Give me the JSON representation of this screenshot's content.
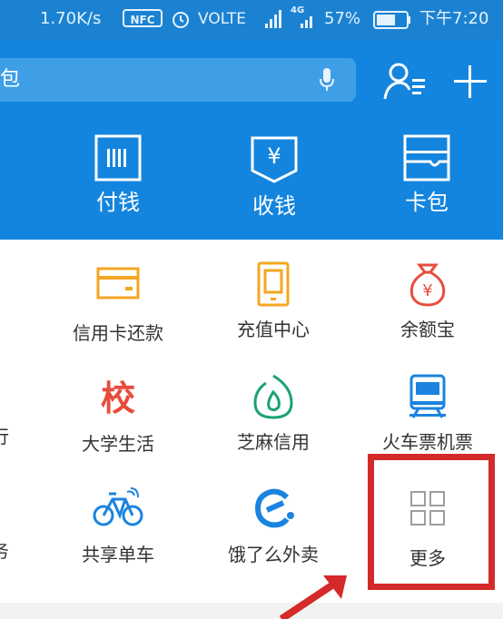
{
  "status_bar": {
    "speed": "1.70K/s",
    "nfc": "NFC",
    "volte": "VOLTE",
    "network": "4G",
    "battery": "57%",
    "time": "下午7:20"
  },
  "search": {
    "visible_text": "包"
  },
  "top_actions": [
    {
      "label": "付钱",
      "icon": "barcode-icon"
    },
    {
      "label": "收钱",
      "icon": "yuan-receive-icon"
    },
    {
      "label": "卡包",
      "icon": "card-wallet-icon"
    }
  ],
  "grid": {
    "row1": [
      {
        "label": "信用卡还款",
        "icon": "credit-card-icon"
      },
      {
        "label": "充值中心",
        "icon": "phone-recharge-icon"
      },
      {
        "label": "余额宝",
        "icon": "money-bag-icon"
      }
    ],
    "row2_partial_left": "行",
    "row2": [
      {
        "label": "大学生活",
        "icon": "school-icon",
        "glyph": "校"
      },
      {
        "label": "芝麻信用",
        "icon": "sesame-credit-icon"
      },
      {
        "label": "火车票机票",
        "icon": "train-icon"
      }
    ],
    "row3_partial_left": "务",
    "row3": [
      {
        "label": "共享单车",
        "icon": "bicycle-icon"
      },
      {
        "label": "饿了么外卖",
        "icon": "eleme-icon"
      },
      {
        "label": "更多",
        "icon": "more-grid-icon"
      }
    ]
  },
  "colors": {
    "header_blue": "#1485de",
    "status_blue": "#1b82d2",
    "highlight_red": "#d42a2a",
    "orange": "#f5a623",
    "red": "#e84c3d",
    "green": "#1aa17a",
    "blue": "#1a84e0",
    "gray": "#9e9e9e"
  }
}
